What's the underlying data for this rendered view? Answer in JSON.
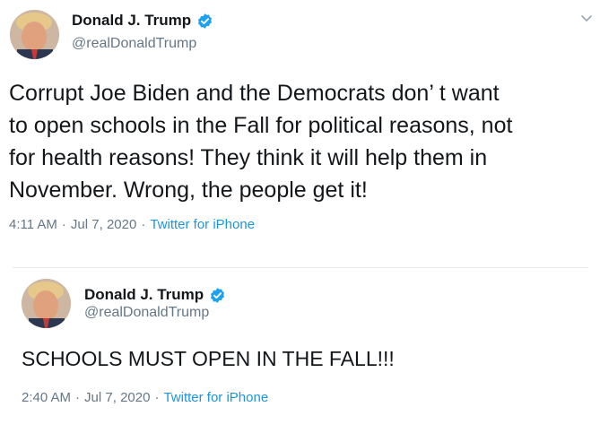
{
  "colors": {
    "text": "#14171a",
    "secondary": "#657786",
    "link": "#1b95e0",
    "verified": "#1da1f2"
  },
  "tweets": [
    {
      "display_name": "Donald J. Trump",
      "handle": "@realDonaldTrump",
      "avatar_icon": "profile-photo",
      "verified_icon": "verified-badge-icon",
      "menu_icon": "chevron-down-icon",
      "text": "Corrupt Joe Biden and the Democrats don’ t want\nto open schools in the Fall for political reasons, not\nfor health reasons! They think it will help them in\nNovember. Wrong, the people get it!",
      "time": "4:11 AM",
      "date": "Jul 7, 2020",
      "source": "Twitter for iPhone",
      "separator": "·"
    },
    {
      "display_name": "Donald J. Trump",
      "handle": "@realDonaldTrump",
      "avatar_icon": "profile-photo",
      "verified_icon": "verified-badge-icon",
      "text": "SCHOOLS MUST OPEN IN THE FALL!!!",
      "time": "2:40 AM",
      "date": "Jul 7, 2020",
      "source": "Twitter for iPhone",
      "separator": "·"
    }
  ]
}
